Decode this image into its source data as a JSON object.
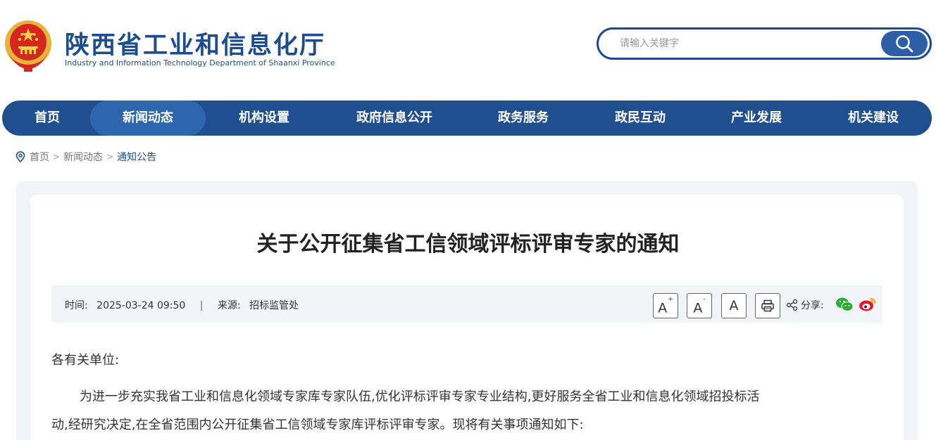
{
  "header": {
    "site_title": "陕西省工业和信息化厅",
    "site_subtitle": "Industry and Information Technology Department of Shaanxi Province",
    "emblem_icon": "national-emblem-icon",
    "brand_color": "#1d4d8f"
  },
  "search": {
    "placeholder": "请输入关键字",
    "icon": "search-icon"
  },
  "nav": {
    "items": [
      {
        "label": "首页"
      },
      {
        "label": "新闻动态"
      },
      {
        "label": "机构设置"
      },
      {
        "label": "政府信息公开"
      },
      {
        "label": "政务服务"
      },
      {
        "label": "政民互动"
      },
      {
        "label": "产业发展"
      },
      {
        "label": "机关建设"
      }
    ],
    "active_index": 1
  },
  "breadcrumb": {
    "icon": "location-pin-icon",
    "items": [
      "首页",
      "新闻动态",
      "通知公告"
    ],
    "separator": ">"
  },
  "article": {
    "title": "关于公开征集省工信领域评标评审专家的通知",
    "meta": {
      "time_label": "时间:",
      "time_value": "2025-03-24 09:50",
      "divider": "|",
      "source_label": "来源:",
      "source_value": "招标监管处"
    },
    "tools": {
      "font_large": "A",
      "font_large_mark": "+",
      "font_small": "A",
      "font_small_mark": "-",
      "font_default": "A",
      "print_icon": "printer-icon",
      "share_icon": "share-icon",
      "share_label": "分享:",
      "wechat_icon": "wechat-icon",
      "weibo_icon": "weibo-icon"
    },
    "paragraphs": [
      "各有关单位:",
      "为进一步充实我省工业和信息化领域专家库专家队伍,优化评标评审专家专业结构,更好服务全省工业和信息化领域招投标活",
      "动,经研究决定,在全省范围内公开征集省工信领域专家库评标评审专家。现将有关事项通知如下:"
    ]
  }
}
